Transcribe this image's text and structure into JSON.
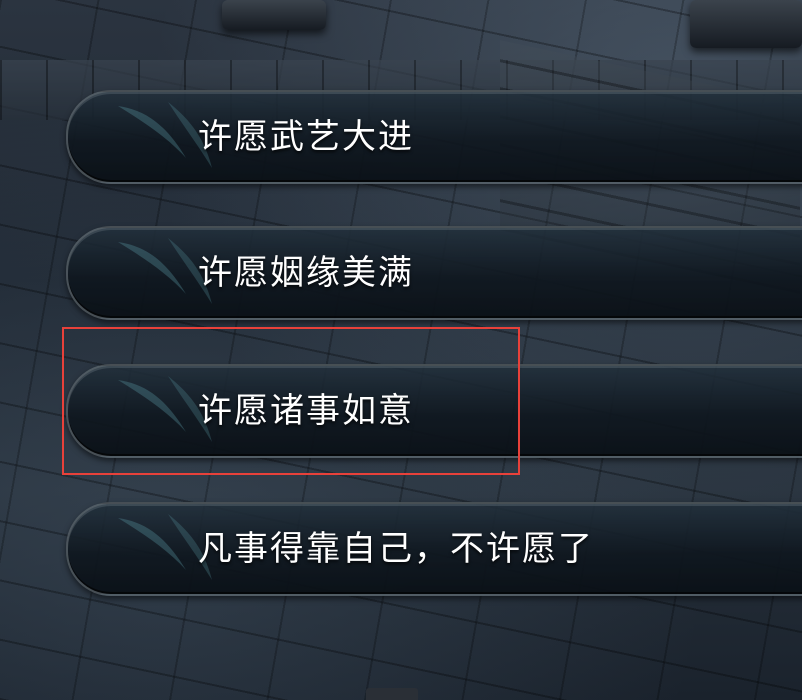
{
  "dialog": {
    "options": [
      {
        "label": "许愿武艺大进"
      },
      {
        "label": "许愿姻缘美满"
      },
      {
        "label": "许愿诸事如意"
      },
      {
        "label": "凡事得靠自己，不许愿了"
      }
    ],
    "highlighted_index": 2
  },
  "colors": {
    "highlight_border": "#e8413a",
    "option_text": "#ffffff",
    "option_fill": "#0f171f"
  },
  "icons": {
    "option_decoration": "brush-stroke-icon"
  }
}
